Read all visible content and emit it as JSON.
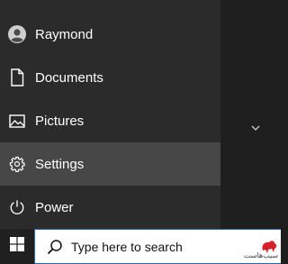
{
  "start_menu": {
    "items": [
      {
        "label": "Raymond",
        "icon": "user-avatar-icon"
      },
      {
        "label": "Documents",
        "icon": "document-icon"
      },
      {
        "label": "Pictures",
        "icon": "image-icon"
      },
      {
        "label": "Settings",
        "icon": "gear-icon",
        "selected": true
      },
      {
        "label": "Power",
        "icon": "power-icon"
      }
    ]
  },
  "taskbar": {
    "search_placeholder": "Type here to search"
  },
  "watermark": {
    "text": "سیب‌هاست",
    "icon": "watermark-logo"
  },
  "colors": {
    "menu_bg": "#2b2b2b",
    "selected_bg": "#474747",
    "taskbar_bg": "#202020",
    "search_border": "#2d64b5"
  }
}
